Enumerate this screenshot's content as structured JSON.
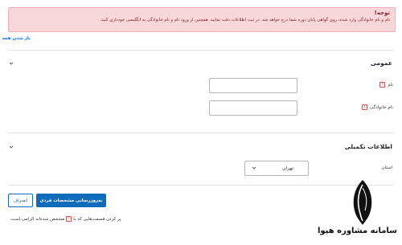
{
  "alert": {
    "title": "توجه!",
    "text": "نام و نام خانوادگی وارد شده، روی گواهی پایان دوره شما درج خواهد شد. در ثبت اطلاعات دقت نمایید. همچنین از ورود نام و نام خانوادگی به انگلیسی خودداری کنید."
  },
  "expand_all": "باز شدن همه",
  "sections": {
    "general": {
      "title": "عمومی",
      "first_name_label": "نام",
      "last_name_label": "نام خانوادگی",
      "first_name_value": "",
      "last_name_value": ""
    },
    "extra": {
      "title": "اطلاعات تکمیلی",
      "province_label": "استان",
      "province_value": "تهران"
    }
  },
  "buttons": {
    "update": "به‌روزرسانی مشخصات فردی",
    "cancel": "انصراف"
  },
  "footnote": {
    "text_before": "پر کردن قسمت‌هایی که با",
    "text_after": "مشخص شده‌اند الزامی است."
  },
  "watermark": {
    "text": "سامانه مشاوره هپوا"
  },
  "colors": {
    "primary": "#0f6cbd",
    "alert_bg": "#f8d7da",
    "alert_text": "#842029",
    "required": "#d9534f"
  },
  "icons": {
    "required": "exclamation-icon",
    "collapse": "chevron-down-icon",
    "select_caret": "caret-down-icon",
    "logo": "feather-quill-icon"
  }
}
